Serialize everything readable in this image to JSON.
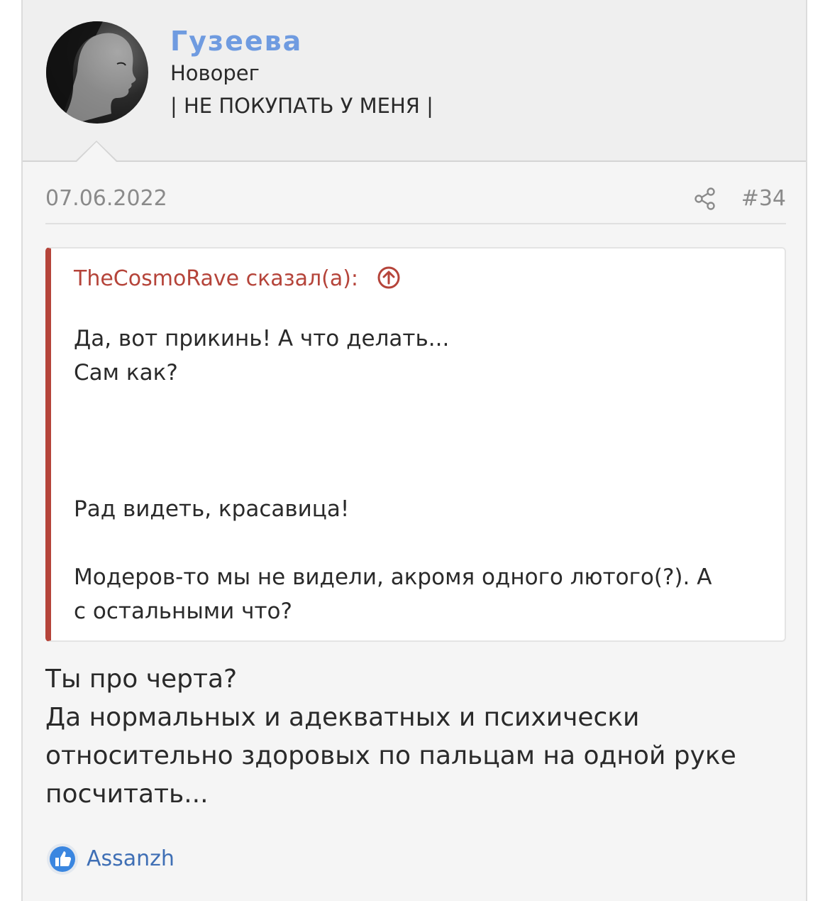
{
  "user": {
    "name": "Гузеева",
    "title": "Новорег",
    "banner": "| НЕ ПОКУПАТЬ У МЕНЯ |",
    "avatar_icon": "avatar-photo"
  },
  "post": {
    "date": "07.06.2022",
    "number": "#34",
    "share_icon": "share-icon"
  },
  "quote": {
    "author": "TheCosmoRave сказал(а):",
    "jump_icon": "arrow-up-circle-icon",
    "lines": [
      "Да, вот прикинь! А что делать...",
      "Сам как?",
      "Рад видеть, красавица!",
      "Модеров-то мы не видели, акромя одного лютого(?). А",
      "с остальными что?"
    ]
  },
  "message": {
    "lines": [
      "Ты про черта?",
      "Да нормальных и адекватных и психически",
      "относительно здоровых по пальцам на одной руке",
      "посчитать..."
    ]
  },
  "reactions": {
    "icon": "thumbs-up-icon",
    "user": "Assanzh"
  },
  "colors": {
    "username": "#6f9be0",
    "quote_accent": "#b5443a",
    "reaction_link": "#3f6fb5"
  }
}
